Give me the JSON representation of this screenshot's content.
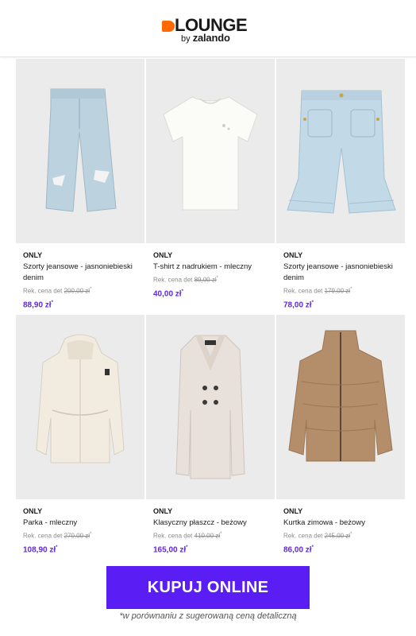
{
  "header": {
    "brand_word": "LOUNGE",
    "brand_sub_prefix": "by",
    "brand_sub_name": "zalando",
    "brand_color": "#ff6900"
  },
  "products": [
    {
      "brand": "ONLY",
      "name": "Szorty jeansowe - jasnoniebieski denim",
      "rrp_label": "Rek. cena det",
      "rrp_value": "200,00 zł",
      "rrp_mark": "*",
      "price": "88,90 zł",
      "price_mark": "*",
      "icon": "denim-culottes"
    },
    {
      "brand": "ONLY",
      "name": "T-shirt z nadrukiem - mleczny",
      "rrp_label": "Rek. cena det",
      "rrp_value": "89,00 zł",
      "rrp_mark": "*",
      "price": "40,00 zł",
      "price_mark": "*",
      "icon": "white-tshirt"
    },
    {
      "brand": "ONLY",
      "name": "Szorty jeansowe - jasnoniebieski denim",
      "rrp_label": "Rek. cena det",
      "rrp_value": "179,00 zł",
      "rrp_mark": "*",
      "price": "78,00 zł",
      "price_mark": "*",
      "icon": "denim-shorts"
    },
    {
      "brand": "ONLY",
      "name": "Parka - mleczny",
      "rrp_label": "Rek. cena det",
      "rrp_value": "270,00 zł",
      "rrp_mark": "*",
      "price": "108,90 zł",
      "price_mark": "*",
      "icon": "cream-parka"
    },
    {
      "brand": "ONLY",
      "name": "Klasyczny płaszcz - beżowy",
      "rrp_label": "Rek. cena det",
      "rrp_value": "410,00 zł",
      "rrp_mark": "*",
      "price": "165,00 zł",
      "price_mark": "*",
      "icon": "beige-coat"
    },
    {
      "brand": "ONLY",
      "name": "Kurtka zimowa - beżowy",
      "rrp_label": "Rek. cena det",
      "rrp_value": "245,00 zł",
      "rrp_mark": "*",
      "price": "86,00 zł",
      "price_mark": "*",
      "icon": "puffer-jacket"
    }
  ],
  "cta": {
    "label": "KUPUJ ONLINE",
    "color": "#5a1ef5"
  },
  "footnote": "*w porównaniu z sugerowaną ceną detaliczną",
  "colors": {
    "price": "#6328e0",
    "image_bg": "#ebebeb"
  }
}
